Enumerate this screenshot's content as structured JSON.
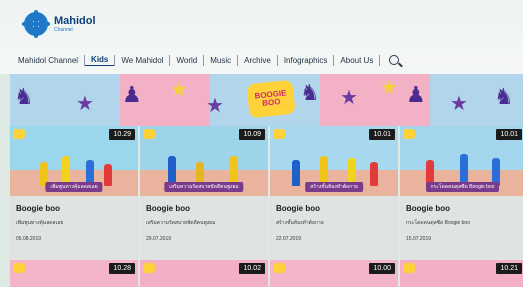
{
  "header": {
    "logo_name": "Mahidol",
    "logo_sub": "Channel"
  },
  "nav": {
    "items": [
      "Mahidol Channel",
      "Kids",
      "We Mahidol",
      "World",
      "Music",
      "Archive",
      "Infographics",
      "About Us"
    ],
    "active": "Kids"
  },
  "banner": {
    "logo_line1": "BOOGIE",
    "logo_line2": "BOO"
  },
  "videos": [
    {
      "title": "Boogie boo",
      "desc": "เพิ่มพูนทางคุ้มลดสเลย",
      "date": "05.08.2019",
      "duration": "10.29",
      "caption": "เพิ่มพูนทางคุ้มลดสเลย",
      "bg": "#9ad7ec"
    },
    {
      "title": "Boogie boo",
      "desc": "เสริมความรัดสบายชัดดีตนพูงยม",
      "date": "29.07.2019",
      "duration": "10.09",
      "caption": "เสริมความรัดสบายชัดดีตนพูงยม",
      "bg": "#9dd4ea"
    },
    {
      "title": "Boogie boo",
      "desc": "สร้างชั้นท้องทำต้อกาย",
      "date": "22.07.2019",
      "duration": "10.01",
      "caption": "สร้างชั้นท้องทำต้อกาย",
      "bg": "#a8d8ee"
    },
    {
      "title": "Boogie boo",
      "desc": "กระโดดคนตุลซีด Boogie boo",
      "date": "15.07.2019",
      "duration": "10.01",
      "caption": "กระโดดคนตุลซีด Boogie boo",
      "bg": "#a3d6ec"
    }
  ],
  "videos_row2": [
    {
      "duration": "10.28"
    },
    {
      "duration": "10.02"
    },
    {
      "duration": "10.00"
    },
    {
      "duration": "10.21"
    }
  ]
}
